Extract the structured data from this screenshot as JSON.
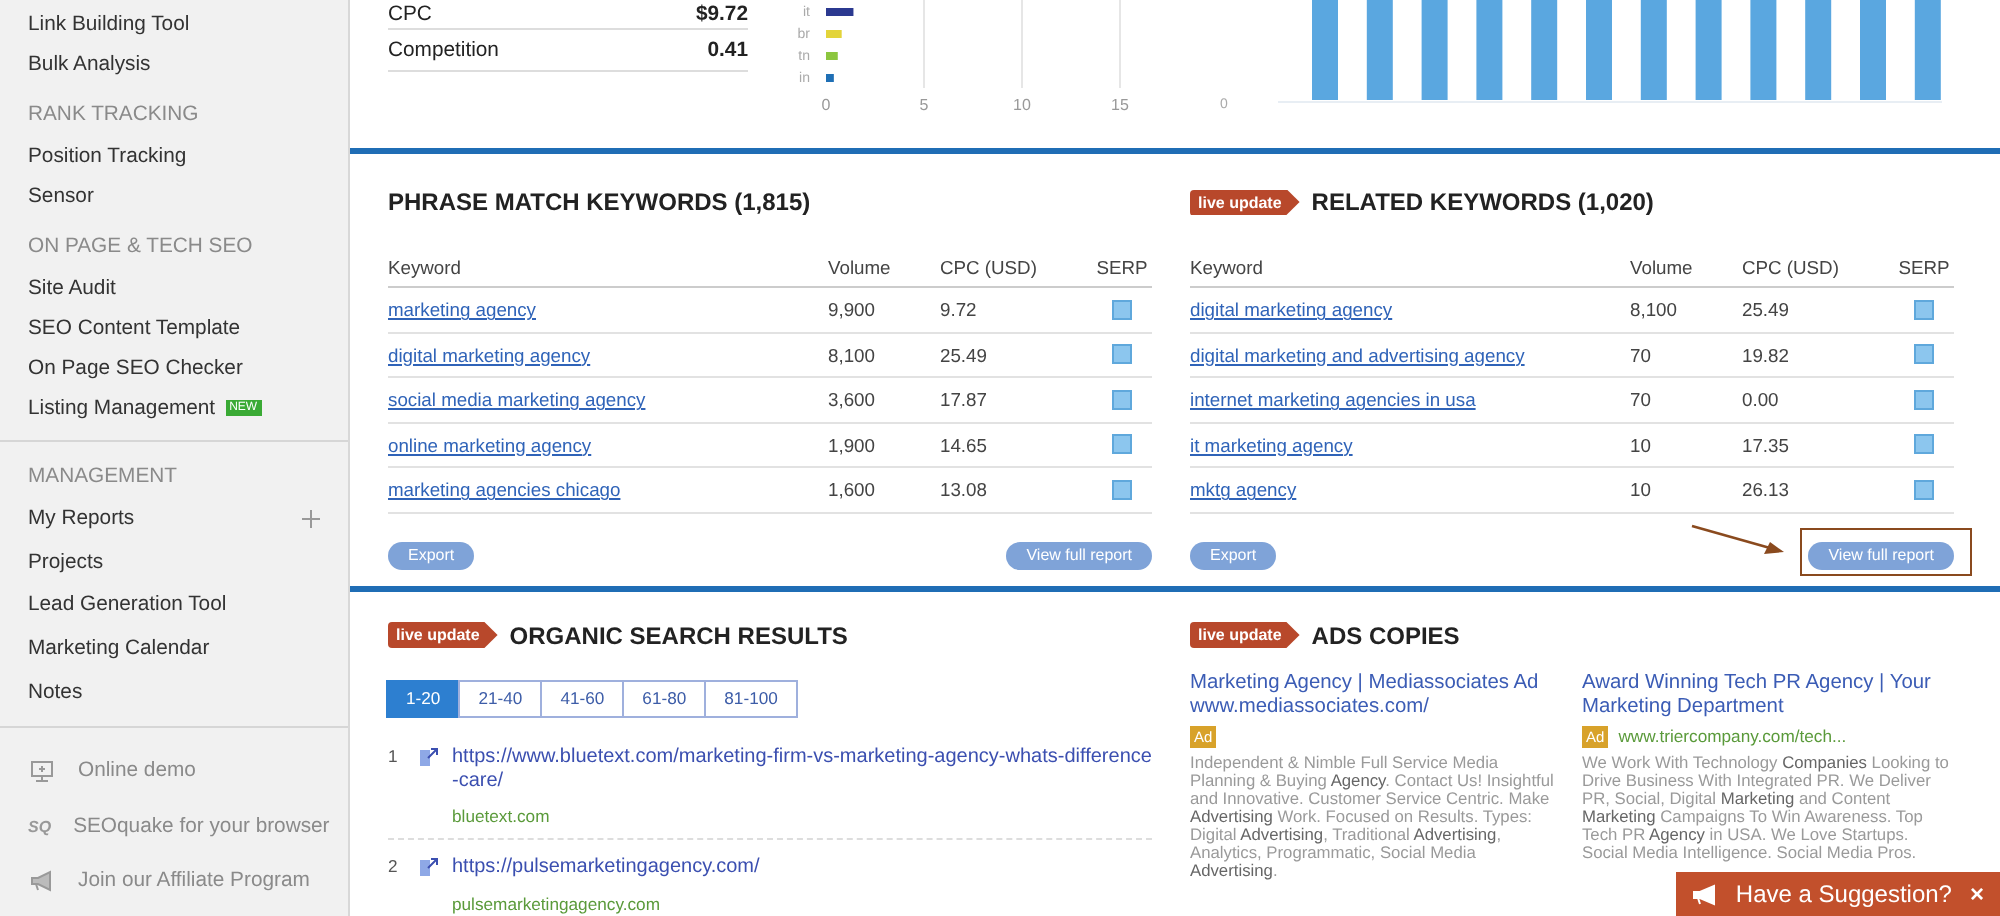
{
  "sidebar": {
    "sections": [
      {
        "groups": [
          {
            "items": [
              {
                "label": "Link Building Tool"
              },
              {
                "label": "Bulk Analysis"
              }
            ]
          },
          {
            "heading": "RANK TRACKING",
            "items": [
              {
                "label": "Position Tracking"
              },
              {
                "label": "Sensor"
              }
            ]
          },
          {
            "heading": "ON PAGE & TECH SEO",
            "items": [
              {
                "label": "Site Audit"
              },
              {
                "label": "SEO Content Template"
              },
              {
                "label": "On Page SEO Checker"
              },
              {
                "label": "Listing Management",
                "badge": "NEW"
              }
            ]
          }
        ]
      },
      {
        "groups": [
          {
            "heading": "MANAGEMENT",
            "items": [
              {
                "label": "My Reports",
                "addable": true
              },
              {
                "label": "Projects"
              },
              {
                "label": "Lead Generation Tool"
              },
              {
                "label": "Marketing Calendar"
              },
              {
                "label": "Notes"
              }
            ]
          }
        ]
      }
    ],
    "footer": [
      {
        "kind": "demo",
        "label": "Online demo"
      },
      {
        "kind": "seoquake",
        "icon_text": "SQ",
        "label": "SEOquake for your browser"
      },
      {
        "kind": "affiliate",
        "label": "Join our Affiliate Program"
      }
    ]
  },
  "summary": {
    "metrics": [
      {
        "label": "CPC",
        "value": "$9.72"
      },
      {
        "label": "Competition",
        "value": "0.41"
      }
    ],
    "chart_data": {
      "type": "bar",
      "orientation": "horizontal",
      "categories": [
        "it",
        "br",
        "tn",
        "in"
      ],
      "values": [
        1.4,
        0.8,
        0.6,
        0.4
      ],
      "colors": [
        "#2b3990",
        "#e3d43a",
        "#8cc63f",
        "#1f6fb5"
      ],
      "xlim": [
        0,
        15
      ],
      "xticks": [
        0,
        5,
        10,
        15
      ]
    },
    "trend_chart": {
      "axis_label": "0"
    }
  },
  "keyword_panels": [
    {
      "title": "PHRASE MATCH KEYWORDS (1,815)",
      "columns": [
        "Keyword",
        "Volume",
        "CPC (USD)",
        "SERP"
      ],
      "rows": [
        {
          "keyword": "marketing agency",
          "volume": "9,900",
          "cpc": "9.72"
        },
        {
          "keyword": "digital marketing agency",
          "volume": "8,100",
          "cpc": "25.49"
        },
        {
          "keyword": "social media marketing agency",
          "volume": "3,600",
          "cpc": "17.87"
        },
        {
          "keyword": "online marketing agency",
          "volume": "1,900",
          "cpc": "14.65"
        },
        {
          "keyword": "marketing agencies chicago",
          "volume": "1,600",
          "cpc": "13.08"
        }
      ],
      "buttons": [
        "Export",
        "View full report"
      ],
      "highlighted": false
    },
    {
      "badge": "live update",
      "title": "RELATED KEYWORDS (1,020)",
      "columns": [
        "Keyword",
        "Volume",
        "CPC (USD)",
        "SERP"
      ],
      "rows": [
        {
          "keyword": "digital marketing agency",
          "volume": "8,100",
          "cpc": "25.49"
        },
        {
          "keyword": "digital marketing and advertising agency",
          "volume": "70",
          "cpc": "19.82"
        },
        {
          "keyword": "internet marketing agencies in usa",
          "volume": "70",
          "cpc": "0.00"
        },
        {
          "keyword": "it marketing agency",
          "volume": "10",
          "cpc": "17.35"
        },
        {
          "keyword": "mktg agency",
          "volume": "10",
          "cpc": "26.13"
        }
      ],
      "buttons": [
        "Export",
        "View full report"
      ],
      "highlighted": true
    }
  ],
  "organic": {
    "badge": "live update",
    "title": "ORGANIC SEARCH RESULTS",
    "pages": [
      {
        "label": "1-20",
        "selected": true
      },
      {
        "label": "21-40",
        "selected": false
      },
      {
        "label": "41-60",
        "selected": false
      },
      {
        "label": "61-80",
        "selected": false
      },
      {
        "label": "81-100",
        "selected": false
      }
    ],
    "results": [
      {
        "rank": "1",
        "url": "https://www.bluetext.com/marketing-firm-vs-marketing-agency-whats-difference-care/",
        "domain": "bluetext.com"
      },
      {
        "rank": "2",
        "url": "https://pulsemarketingagency.com/",
        "domain": "pulsemarketingagency.com"
      }
    ]
  },
  "ads": {
    "badge": "live update",
    "title": "ADS COPIES",
    "items": [
      {
        "title": "Marketing Agency | Mediassociates Ad www.mediassociates.com/",
        "ad_label": "Ad",
        "description": "Independent & Nimble Full Service Media Planning & Buying **Agency**. Contact Us! Insightful and Innovative. Customer Service Centric. Make **Advertising** Work. Focused on Results. Types: Digital **Advertising**, Traditional **Advertising**, Analytics, Programmatic, Social Media **Advertising**."
      },
      {
        "title": "Award Winning Tech PR Agency | Your Marketing Department",
        "ad_label": "Ad",
        "url": "www.triercompany.com/tech...",
        "description": "We Work With Technology **Companies** Looking to Drive Business With Integrated PR. We Deliver PR, Social, Digital **Marketing** and Content **Marketing** Campaigns To Win Awareness. Top Tech PR **Agency** in USA. We Love Startups. Social Media Intelligence. Social Media Pros."
      }
    ]
  },
  "suggestion": {
    "label": "Have a Suggestion?",
    "close": "×"
  }
}
